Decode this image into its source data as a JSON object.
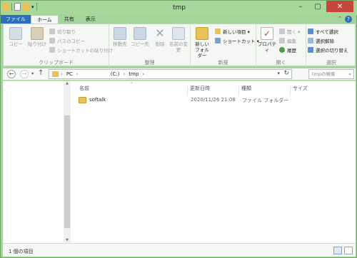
{
  "window": {
    "title": "tmp"
  },
  "ribbon_tabs": [
    "ファイル",
    "ホーム",
    "共有",
    "表示"
  ],
  "clipboard": {
    "copy": "コピー",
    "paste": "貼り付け",
    "cut": "切り取り",
    "copy_path": "パスのコピー",
    "paste_shortcut": "ショートカットの貼り付け",
    "label": "クリップボード"
  },
  "organize": {
    "move_to": "移動先",
    "copy_to": "コピー先",
    "delete": "削除",
    "rename": "名前の変更",
    "label": "整理"
  },
  "new": {
    "new_folder": "新しいフォルダー",
    "new_item": "新しい項目 ▾",
    "shortcut": "ショートカット ▾",
    "label": "新規"
  },
  "open": {
    "properties": "プロパティ",
    "open": "開く ▾",
    "edit": "編集",
    "history": "履歴",
    "label": "開く"
  },
  "select": {
    "select_all": "すべて選択",
    "select_none": "選択解除",
    "invert": "選択の切り替え",
    "label": "選択"
  },
  "address": {
    "pc": "PC",
    "drive": "(C:)",
    "folder": "tmp",
    "search_placeholder": "tmpの検索"
  },
  "columns": [
    "名前",
    "更新日時",
    "種類",
    "サイズ"
  ],
  "files": [
    {
      "name": "softalk",
      "modified": "2020/11/26 21:08",
      "type": "ファイル フォルダー"
    }
  ],
  "status": {
    "count": "1 個の項目"
  },
  "colors": {
    "accent": "#2b6ebd",
    "frame": "#a6d89c",
    "close": "#c7463c",
    "folder": "#e8c35a"
  }
}
